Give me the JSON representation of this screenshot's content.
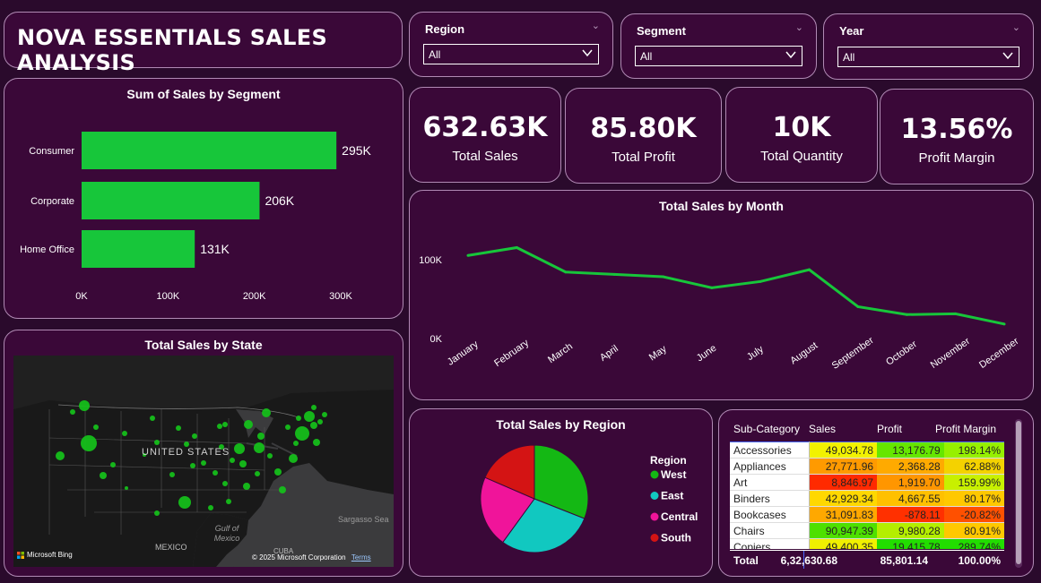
{
  "dashboard": {
    "title": "NOVA ESSENTIALS SALES ANALYSIS"
  },
  "slicers": [
    {
      "label": "Region",
      "value": "All"
    },
    {
      "label": "Segment",
      "value": "All"
    },
    {
      "label": "Year",
      "value": "All"
    }
  ],
  "kpis": {
    "sales": {
      "value": "632.63K",
      "label": "Total Sales"
    },
    "profit": {
      "value": "85.80K",
      "label": "Total Profit"
    },
    "quantity": {
      "value": "10K",
      "label": "Total Quantity"
    },
    "margin": {
      "value": "13.56%",
      "label": "Profit Margin"
    }
  },
  "colors": {
    "bar": "#17c63a",
    "line": "#17c63a",
    "west": "#14b814",
    "east": "#11c8c0",
    "central": "#f0149a",
    "south": "#d41414"
  },
  "chart_data": [
    {
      "type": "bar",
      "orientation": "horizontal",
      "title": "Sum of Sales by Segment",
      "categories": [
        "Consumer",
        "Corporate",
        "Home Office"
      ],
      "values": [
        295,
        206,
        131
      ],
      "data_labels": [
        "295K",
        "206K",
        "131K"
      ],
      "xlim": [
        0,
        300
      ],
      "xticks": [
        "0K",
        "100K",
        "200K",
        "300K"
      ]
    },
    {
      "type": "line",
      "title": "Total Sales by Month",
      "categories": [
        "January",
        "February",
        "March",
        "April",
        "May",
        "June",
        "July",
        "August",
        "September",
        "October",
        "November",
        "December"
      ],
      "values": [
        94,
        104,
        73,
        70,
        67,
        53,
        61,
        76,
        29,
        19,
        20,
        7
      ],
      "ylim": [
        0,
        100
      ],
      "yticks": [
        "0K",
        "100K"
      ]
    },
    {
      "type": "pie",
      "title": "Total Sales by Region",
      "legend_title": "Region",
      "series": [
        {
          "name": "West",
          "value": 31.0
        },
        {
          "name": "East",
          "value": 29.0
        },
        {
          "name": "Central",
          "value": 21.5
        },
        {
          "name": "South",
          "value": 18.5
        }
      ]
    }
  ],
  "map": {
    "title": "Total Sales by State",
    "labels": {
      "country": "UNITED STATES",
      "mexico": "MEXICO",
      "gulf": "Gulf of Mexico",
      "sea": "Sargasso Sea",
      "cuba": "CUBA"
    },
    "attribution": "Microsoft Bing",
    "copyright": "© 2025 Microsoft Corporation",
    "terms": "Terms"
  },
  "table": {
    "headers": [
      "Sub-Category",
      "Sales",
      "Profit",
      "Profit Margin"
    ],
    "rows": [
      {
        "name": "Accessories",
        "sales": "49,034.78",
        "profit": "13,176.79",
        "margin": "198.14%",
        "sc": "#f2f200",
        "pc": "#66e600",
        "mc": "#96f000"
      },
      {
        "name": "Appliances",
        "sales": "27,771.96",
        "profit": "2,368.28",
        "margin": "62.88%",
        "sc": "#ff9a00",
        "pc": "#ffaa00",
        "mc": "#f4d200"
      },
      {
        "name": "Art",
        "sales": "8,846.97",
        "profit": "1,919.70",
        "margin": "159.99%",
        "sc": "#ff2a00",
        "pc": "#ff9600",
        "mc": "#c8f000"
      },
      {
        "name": "Binders",
        "sales": "42,929.34",
        "profit": "4,667.55",
        "margin": "80.17%",
        "sc": "#ffd800",
        "pc": "#ffc000",
        "mc": "#ffc800"
      },
      {
        "name": "Bookcases",
        "sales": "31,091.83",
        "profit": "-878.11",
        "margin": "-20.82%",
        "sc": "#ffa800",
        "pc": "#ff3000",
        "mc": "#ff5000"
      },
      {
        "name": "Chairs",
        "sales": "90,947.39",
        "profit": "9,980.28",
        "margin": "80.91%",
        "sc": "#4ee000",
        "pc": "#b4ee00",
        "mc": "#ffc800"
      },
      {
        "name": "Copiers",
        "sales": "49,400.35",
        "profit": "19,415.78",
        "margin": "289.74%",
        "sc": "#f0f000",
        "pc": "#22dd00",
        "mc": "#22dd00"
      }
    ],
    "total": {
      "name": "Total",
      "sales": "6,32,630.68",
      "profit": "85,801.14",
      "margin": "100.00%"
    }
  }
}
